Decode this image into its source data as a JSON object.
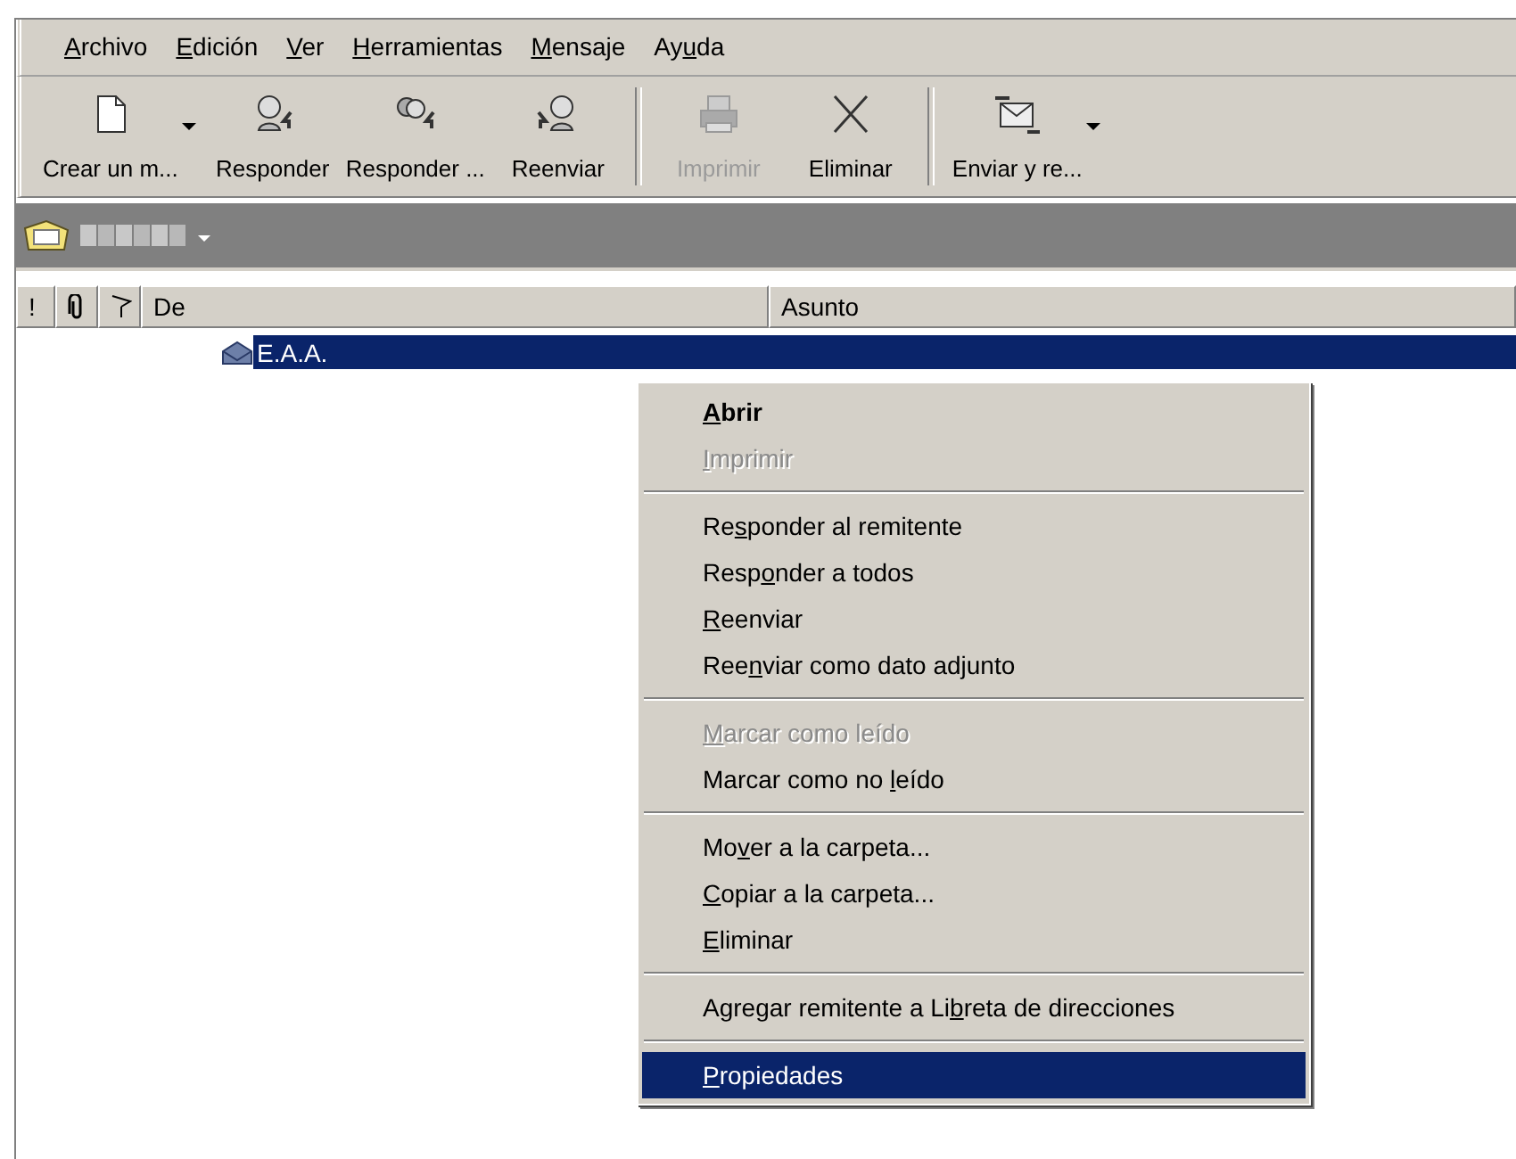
{
  "menu_bar": [
    {
      "key": "A",
      "post": "rchivo"
    },
    {
      "key": "E",
      "post": "dición"
    },
    {
      "key": "V",
      "post": "er"
    },
    {
      "key": "H",
      "post": "erramientas"
    },
    {
      "key": "M",
      "post": "ensaje"
    },
    {
      "pre": "Ay",
      "key": "u",
      "post": "da"
    }
  ],
  "toolbar": [
    [
      {
        "kind": "new",
        "label": "Crear un m...",
        "disabled": false,
        "dropdown": true
      },
      {
        "kind": "reply",
        "label": "Responder",
        "disabled": false,
        "dropdown": false
      },
      {
        "kind": "reply_all",
        "label": "Responder ...",
        "disabled": false,
        "dropdown": false
      },
      {
        "kind": "forward",
        "label": "Reenviar",
        "disabled": false,
        "dropdown": false
      }
    ],
    [
      {
        "kind": "print",
        "label": "Imprimir",
        "disabled": true,
        "dropdown": false
      },
      {
        "kind": "delete",
        "label": "Eliminar",
        "disabled": false,
        "dropdown": false
      }
    ],
    [
      {
        "kind": "send_receive",
        "label": "Enviar y re...",
        "disabled": false,
        "dropdown": true
      }
    ]
  ],
  "columns": [
    {
      "kind": "text",
      "label": "!"
    },
    {
      "kind": "attachment"
    },
    {
      "kind": "flag"
    },
    {
      "kind": "text",
      "label": "De"
    },
    {
      "kind": "text",
      "label": "Asunto"
    }
  ],
  "messages": [
    {
      "from": "E.A.A.",
      "selected": true
    }
  ],
  "context_menu": [
    [
      {
        "key": "A",
        "post": "brir",
        "default": true,
        "disabled": false,
        "selected": false
      },
      {
        "key": "I",
        "post": "mprimir",
        "default": false,
        "disabled": true,
        "selected": false
      }
    ],
    [
      {
        "pre": "Re",
        "key": "s",
        "post": "ponder al remitente",
        "default": false,
        "disabled": false,
        "selected": false
      },
      {
        "pre": "Resp",
        "key": "o",
        "post": "nder a todos",
        "default": false,
        "disabled": false,
        "selected": false
      },
      {
        "key": "R",
        "post": "eenviar",
        "default": false,
        "disabled": false,
        "selected": false
      },
      {
        "pre": "Ree",
        "key": "n",
        "post": "viar como dato adjunto",
        "default": false,
        "disabled": false,
        "selected": false
      }
    ],
    [
      {
        "key": "M",
        "post": "arcar como leído",
        "default": false,
        "disabled": true,
        "selected": false
      },
      {
        "pre": "Marcar como no ",
        "key": "l",
        "post": "eído",
        "default": false,
        "disabled": false,
        "selected": false
      }
    ],
    [
      {
        "pre": "Mo",
        "key": "v",
        "post": "er a la carpeta...",
        "default": false,
        "disabled": false,
        "selected": false
      },
      {
        "key": "C",
        "post": "opiar a la carpeta...",
        "default": false,
        "disabled": false,
        "selected": false
      },
      {
        "key": "E",
        "post": "liminar",
        "default": false,
        "disabled": false,
        "selected": false
      }
    ],
    [
      {
        "pre": "Agregar remitente a Li",
        "key": "b",
        "post": "reta de direcciones",
        "default": false,
        "disabled": false,
        "selected": false
      }
    ],
    [
      {
        "key": "P",
        "post": "ropiedades",
        "default": false,
        "disabled": false,
        "selected": true
      }
    ]
  ]
}
